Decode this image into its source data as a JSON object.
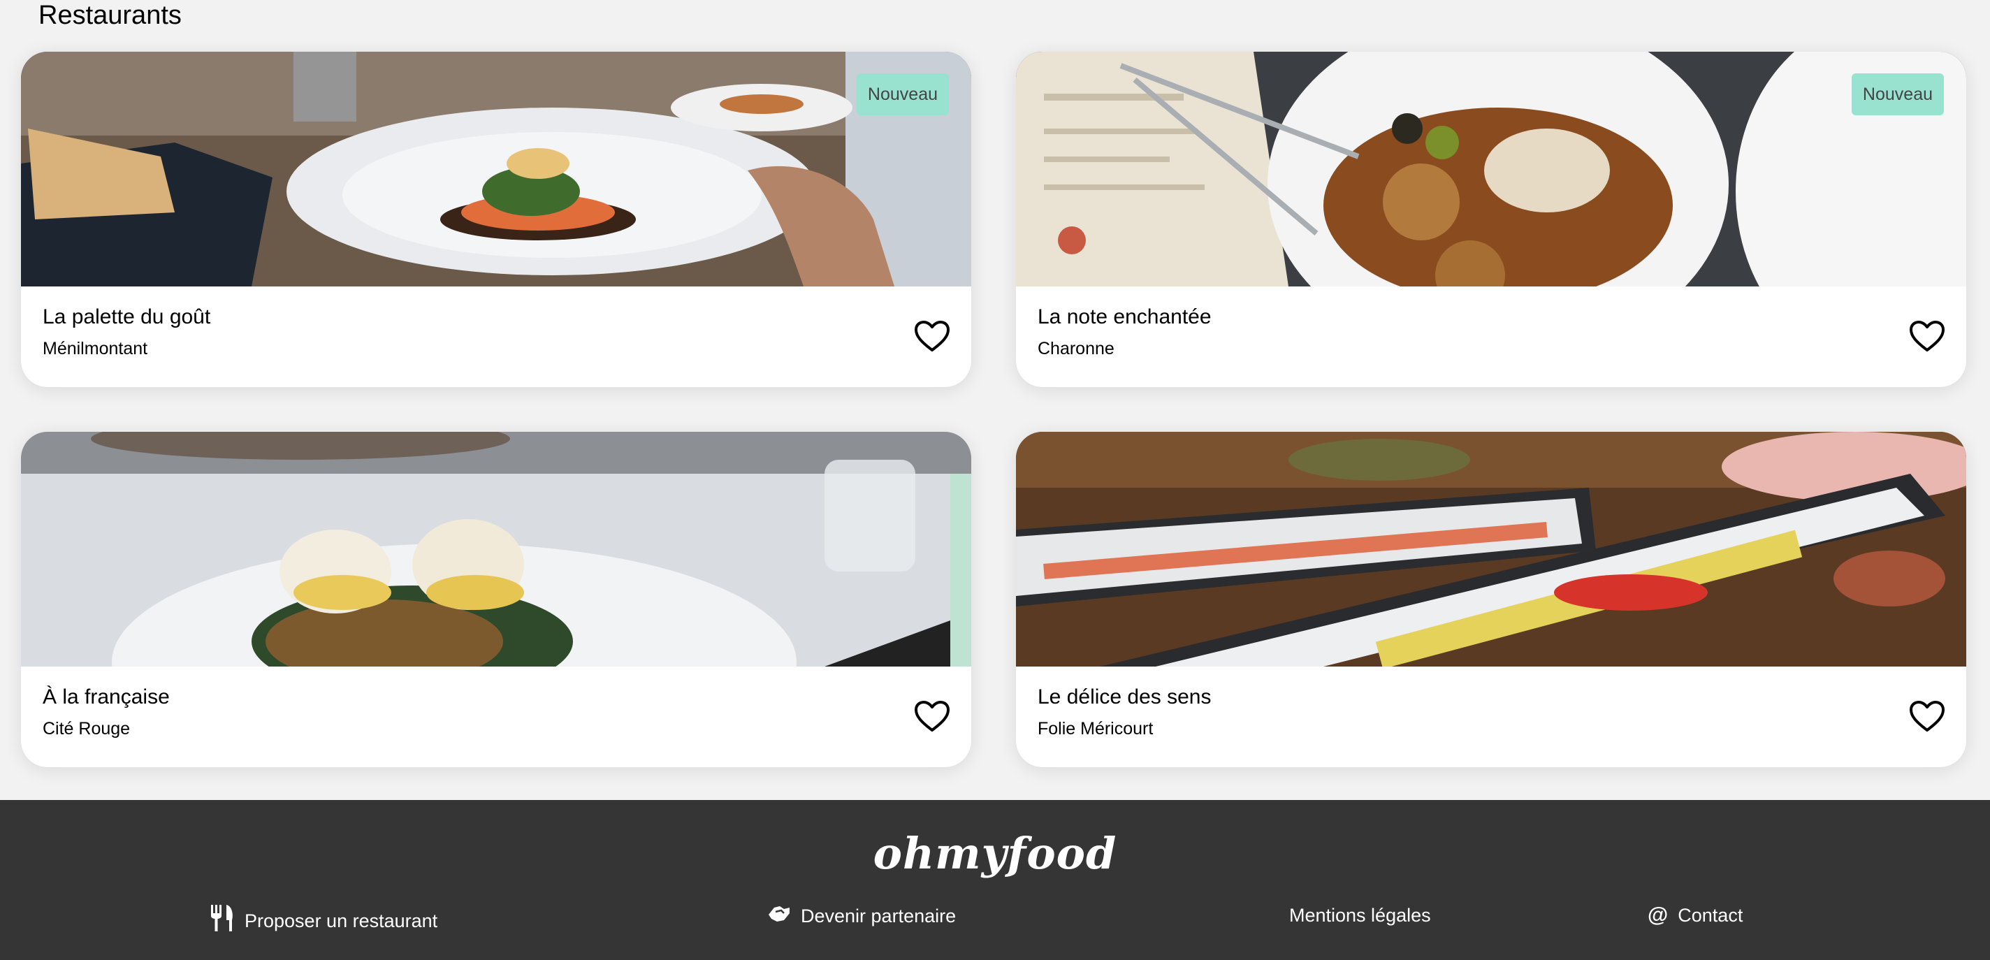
{
  "section": {
    "title": "Restaurants"
  },
  "restaurants": [
    {
      "name": "La palette du goût",
      "area": "Ménilmontant",
      "badge": "Nouveau",
      "favorite_icon": "heart-outline-icon"
    },
    {
      "name": "La note enchantée",
      "area": "Charonne",
      "badge": "Nouveau",
      "favorite_icon": "heart-outline-icon"
    },
    {
      "name": "À la française",
      "area": "Cité Rouge",
      "favorite_icon": "heart-outline-icon"
    },
    {
      "name": "Le délice des sens",
      "area": "Folie Méricourt",
      "favorite_icon": "heart-outline-icon"
    }
  ],
  "footer": {
    "logo": "ohmyfood",
    "links": [
      {
        "label": "Proposer un restaurant",
        "icon": "utensils-icon"
      },
      {
        "label": "Devenir partenaire",
        "icon": "handshake-icon"
      },
      {
        "label": "Mentions légales"
      },
      {
        "label": "Contact",
        "icon": "at-icon"
      }
    ]
  },
  "colors": {
    "page_background": "#f2f2f2",
    "card_background": "#ffffff",
    "badge_background": "#99e2d0",
    "footer_background": "#353535"
  }
}
